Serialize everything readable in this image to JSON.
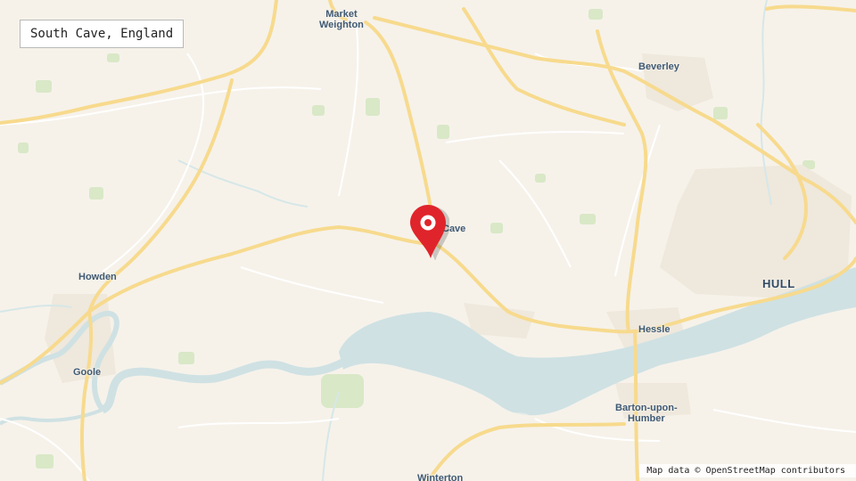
{
  "map": {
    "title": "South Cave, England",
    "attribution": "Map data © OpenStreetMap contributors",
    "marker": {
      "icon": "location-pin-icon",
      "color": "#e0242b"
    },
    "colors": {
      "land": "#f6f2ea",
      "water": "#cfe1e3",
      "major_road": "#f7d98a",
      "minor_road": "#ffffff",
      "woodland": "#d8e9c6",
      "label": "#3f5a75"
    },
    "places": {
      "market_weighton": "Market\nWeighton",
      "beverley": "Beverley",
      "howden": "Howden",
      "goole": "Goole",
      "south_cave": "Cave",
      "hull": "HULL",
      "hessle": "Hessle",
      "barton": "Barton-upon-\nHumber",
      "winterton": "Winterton"
    }
  }
}
